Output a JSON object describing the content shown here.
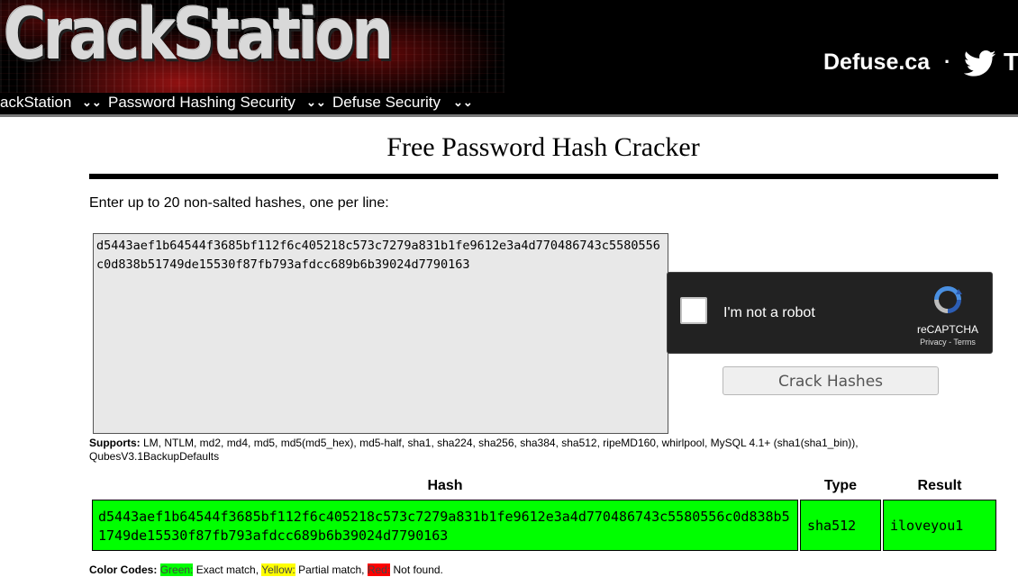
{
  "header": {
    "logo_text": "CrackStation",
    "site_link": "Defuse.ca",
    "separator": "·",
    "social_label_partial": "T",
    "twitter_icon": "twitter-bird-icon"
  },
  "nav": {
    "items": [
      {
        "label": "ackStation",
        "icon": "double-chevron-down-icon"
      },
      {
        "label": "Password Hashing Security",
        "icon": "double-chevron-down-icon"
      },
      {
        "label": "Defuse Security",
        "icon": "double-chevron-down-icon"
      }
    ]
  },
  "main": {
    "title": "Free Password Hash Cracker",
    "instructions": "Enter up to 20 non-salted hashes, one per line:",
    "input_value": "d5443aef1b64544f3685bf112f6c405218c573c7279a831b1fe9612e3a4d770486743c5580556c0d838b51749de15530f87fb793afdcc689b6b39024d7790163",
    "crack_button": "Crack Hashes",
    "supports_label": "Supports:",
    "supports_text": " LM, NTLM, md2, md4, md5, md5(md5_hex), md5-half, sha1, sha224, sha256, sha384, sha512, ripeMD160, whirlpool, MySQL 4.1+ (sha1(sha1_bin)), QubesV3.1BackupDefaults"
  },
  "recaptcha": {
    "label": "I'm not a robot",
    "brand": "reCAPTCHA",
    "terms": "Privacy - Terms",
    "checked": false
  },
  "results": {
    "headers": [
      "Hash",
      "Type",
      "Result"
    ],
    "rows": [
      {
        "hash": "d5443aef1b64544f3685bf112f6c405218c573c7279a831b1fe9612e3a4d770486743c5580556c0d838b51749de15530f87fb793afdcc689b6b39024d7790163",
        "type": "sha512",
        "result": "iloveyou1",
        "status_color": "#00ff00"
      }
    ]
  },
  "legend": {
    "label": "Color Codes:",
    "green": "Green:",
    "green_text": " Exact match, ",
    "yellow": "Yellow:",
    "yellow_text": " Partial match, ",
    "red": "Red:",
    "red_text": " Not found.",
    "colors": {
      "green": "#00ff00",
      "yellow": "#ffff00",
      "red": "#ff0000"
    }
  }
}
